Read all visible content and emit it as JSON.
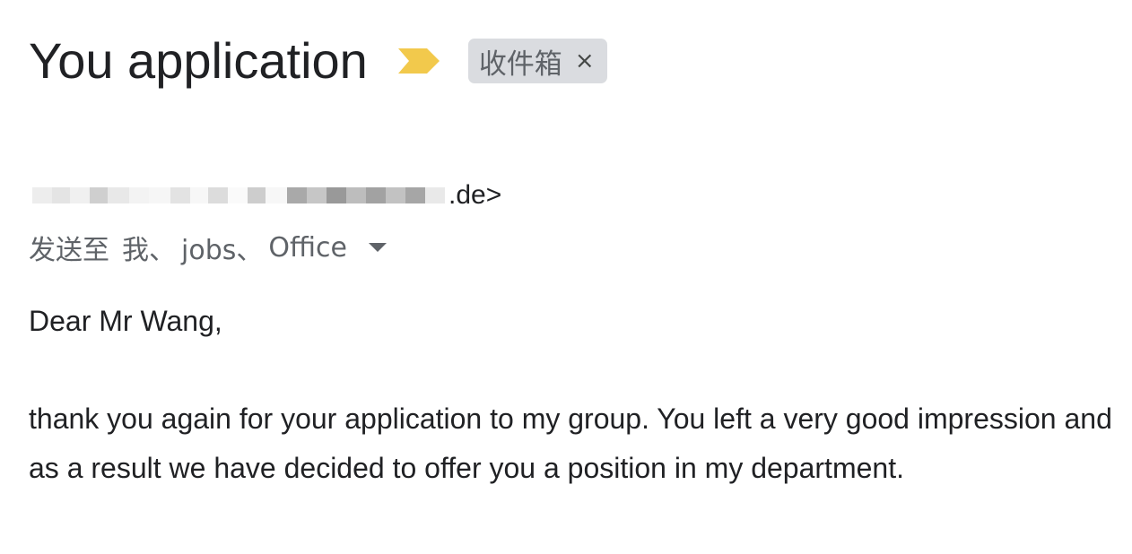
{
  "email": {
    "subject": "You application",
    "label": {
      "text": "收件箱",
      "close_glyph": "×"
    },
    "importance_marker_color": "#f2c94c",
    "sender": {
      "redacted_part_icon": "pixelated-redaction",
      "visible_suffix": ".de>"
    },
    "recipients": {
      "prefix": "发送至",
      "names": [
        "我、",
        "jobs、",
        "Office"
      ],
      "toggle_icon": "caret-down-icon"
    },
    "body": {
      "greeting": "Dear Mr Wang,",
      "paragraph": "thank you again for your application to my group. You left a very good impression and as a result we have decided to offer you a position in my department."
    }
  }
}
